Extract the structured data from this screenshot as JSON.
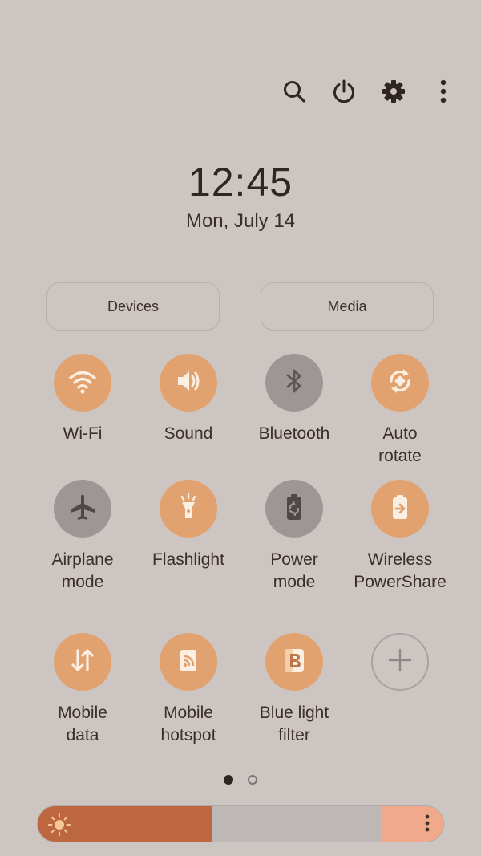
{
  "header": {
    "icons": [
      "search-icon",
      "power-icon",
      "gear-icon",
      "more-vert-icon"
    ]
  },
  "clock": {
    "time": "12:45",
    "date": "Mon, July 14"
  },
  "pills": {
    "devices": "Devices",
    "media": "Media"
  },
  "tiles": [
    {
      "label": "Wi-Fi",
      "icon": "wifi-icon",
      "state": "on"
    },
    {
      "label": "Sound",
      "icon": "sound-icon",
      "state": "on"
    },
    {
      "label": "Bluetooth",
      "icon": "bluetooth-icon",
      "state": "off"
    },
    {
      "label": "Auto\nrotate",
      "icon": "auto-rotate-icon",
      "state": "on"
    },
    {
      "label": "Airplane\nmode",
      "icon": "airplane-icon",
      "state": "off"
    },
    {
      "label": "Flashlight",
      "icon": "flashlight-icon",
      "state": "on"
    },
    {
      "label": "Power\nmode",
      "icon": "power-mode-icon",
      "state": "off"
    },
    {
      "label": "Wireless\nPowerShare",
      "icon": "wireless-powershare-icon",
      "state": "on"
    },
    {
      "label": "Mobile\ndata",
      "icon": "mobile-data-icon",
      "state": "on"
    },
    {
      "label": "Mobile\nhotspot",
      "icon": "hotspot-icon",
      "state": "on"
    },
    {
      "label": "Blue light\nfilter",
      "icon": "blue-light-filter-icon",
      "state": "on"
    },
    {
      "label": "",
      "icon": "add-icon",
      "state": "add"
    }
  ],
  "pager": {
    "pages": 2,
    "current": 1
  },
  "brightness": {
    "level": 0.43
  },
  "colors": {
    "accent": "#e2a26f",
    "off": "#9c9694",
    "background": "#cdc5c2",
    "brightness_fill": "#bd6740"
  }
}
